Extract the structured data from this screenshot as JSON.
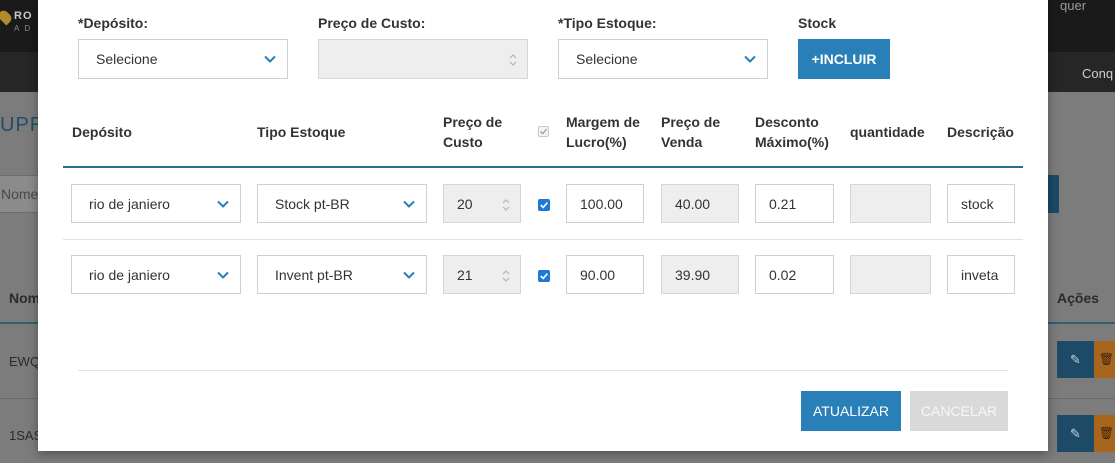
{
  "background": {
    "logo_text": "RO",
    "logo_sub": "AD",
    "user_text": "quer",
    "nav_item": "Conq",
    "page_title": "UPR",
    "search_placeholder": "Nome",
    "table_header_nome": "Nom",
    "table_header_acoes": "Ações",
    "rows": [
      "EWQ",
      "1SAS"
    ]
  },
  "form": {
    "deposito_label": "*Depósito:",
    "deposito_value": "Selecione",
    "preco_custo_label": "Preço de Custo:",
    "preco_custo_value": "",
    "tipo_estoque_label": "*Tipo Estoque:",
    "tipo_estoque_value": "Selecione",
    "stock_label": "Stock",
    "incluir_button": "+INCLUIR"
  },
  "table": {
    "headers": {
      "deposito": "Depósito",
      "tipo_estoque": "Tipo Estoque",
      "preco_custo_1": "Preço de",
      "preco_custo_2": "Custo",
      "margem_1": "Margem de",
      "margem_2": "Lucro(%)",
      "preco_venda_1": "Preço de",
      "preco_venda_2": "Venda",
      "desconto_1": "Desconto",
      "desconto_2": "Máximo(%)",
      "quantidade": "quantidade",
      "descricao": "Descrição"
    },
    "rows": [
      {
        "deposito": "rio de janiero",
        "tipo_estoque": "Stock pt-BR",
        "preco_custo": "20",
        "checked": true,
        "margem": "100.00",
        "preco_venda": "40.00",
        "desconto": "0.21",
        "quantidade": "",
        "descricao": "stock"
      },
      {
        "deposito": "rio de janiero",
        "tipo_estoque": "Invent pt-BR",
        "preco_custo": "21",
        "checked": true,
        "margem": "90.00",
        "preco_venda": "39.90",
        "desconto": "0.02",
        "quantidade": "",
        "descricao": "inveta"
      }
    ]
  },
  "footer": {
    "atualizar_button": "ATUALIZAR",
    "cancelar_button": "CANCELAR"
  },
  "colors": {
    "primary": "#2980b9",
    "header_line": "#2a6e94",
    "checkbox": "#1f7ad6",
    "disabled_button": "#d9d9d9"
  }
}
